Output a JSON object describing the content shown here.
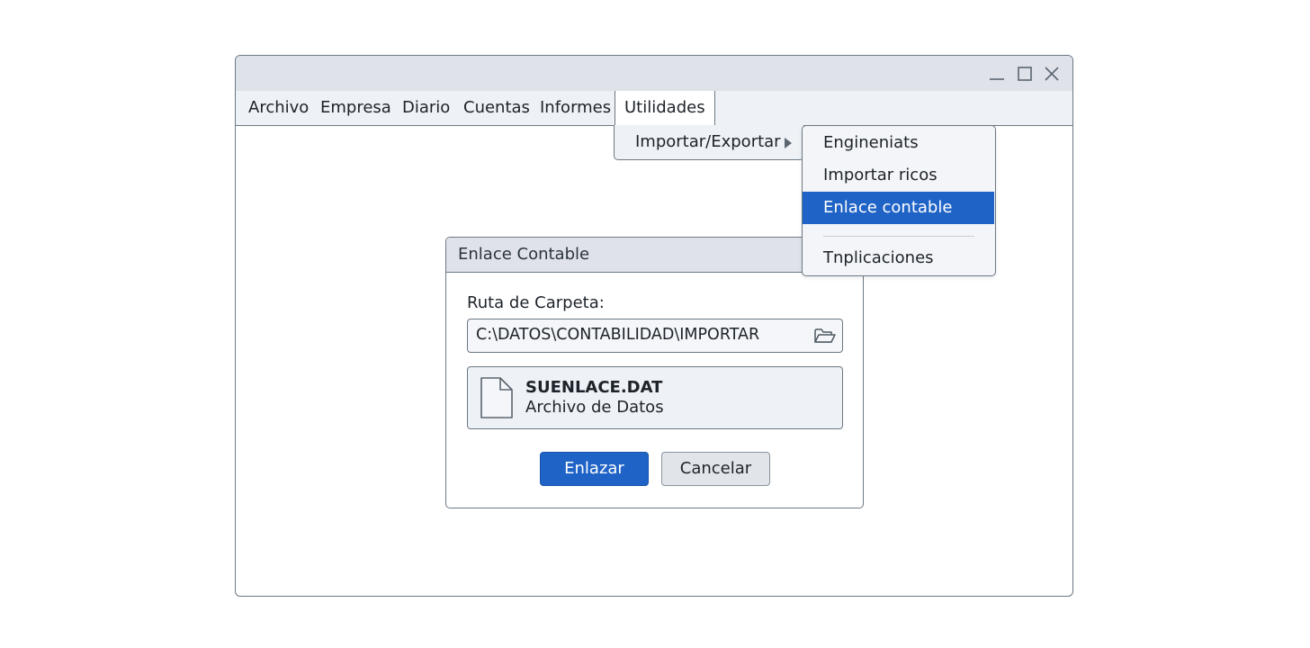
{
  "window": {
    "controls": {
      "minimize": "minimize-icon",
      "maximize": "maximize-icon",
      "close": "close-icon"
    }
  },
  "menubar": {
    "items": [
      "Archivo",
      "Empresa",
      "Diario",
      "Cuentas",
      "Informes",
      "Utilidades"
    ],
    "active": "Utilidades"
  },
  "utilidades_menu": {
    "items": [
      {
        "label": "Importar/Exportar",
        "has_submenu": true
      }
    ]
  },
  "submenu": {
    "items": [
      "Engineniats",
      "Importar ricos",
      "Enlace contable",
      "Tnplicaciones"
    ],
    "selected": "Enlace contable"
  },
  "dialog": {
    "title": "Enlace Contable",
    "folder_label": "Ruta de Carpeta:",
    "folder_path": "C:\\DATOS\\CONTABILIDAD\\IMPORTAR",
    "browse_icon": "folder-open-icon",
    "file": {
      "icon": "file-icon",
      "name": "SUENLACE.DAT",
      "type": "Archivo de Datos"
    },
    "primary_button": "Enlazar",
    "secondary_button": "Cancelar"
  },
  "colors": {
    "accent": "#1f63c6",
    "titlebar": "#dfe3e9",
    "menubar": "#eef1f5",
    "border": "#6d7884"
  }
}
